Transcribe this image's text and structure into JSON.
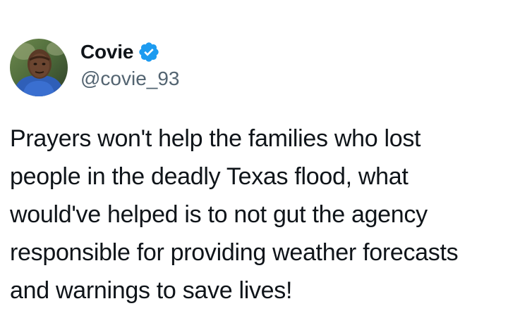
{
  "user": {
    "display_name": "Covie",
    "handle": "@covie_93",
    "verified": true,
    "verified_color": "#1d9bf0",
    "avatar_icon": "profile-photo"
  },
  "tweet": {
    "text": "Prayers won't help the families who lost\npeople in the deadly Texas flood, what\nwould've helped is to not gut the agency\nresponsible for providing weather forecasts\nand warnings to save lives!"
  },
  "colors": {
    "text": "#0f1419",
    "handle": "#536471",
    "background": "#ffffff"
  }
}
